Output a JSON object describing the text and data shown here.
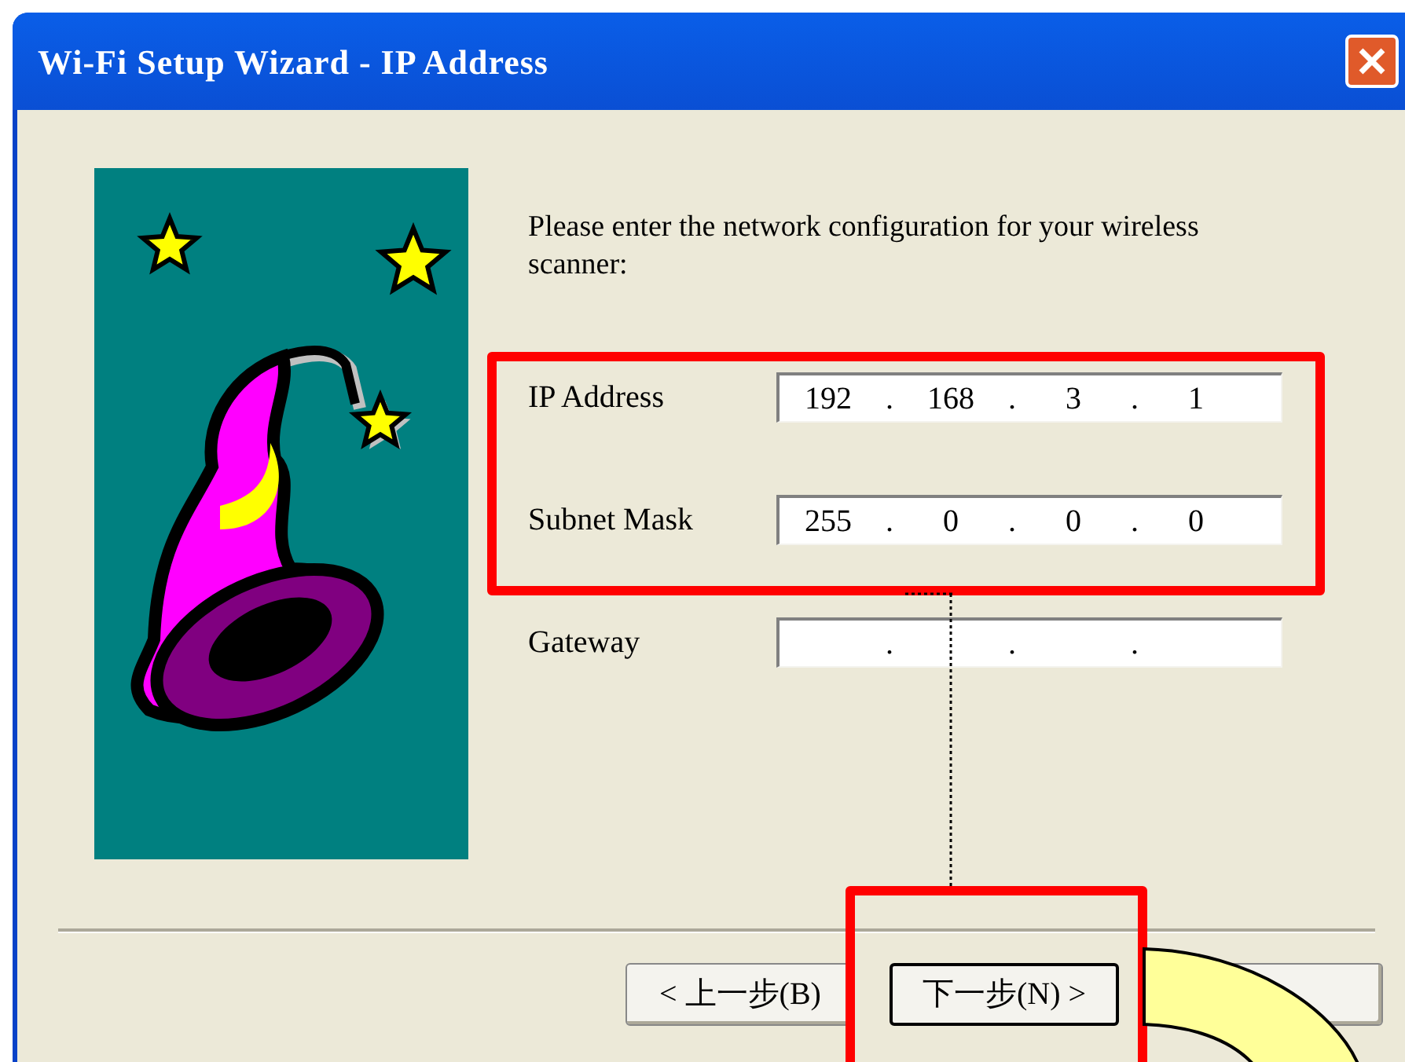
{
  "window": {
    "title": "Wi-Fi Setup Wizard - IP Address"
  },
  "instructions": "Please enter the network configuration for your wireless scanner:",
  "fields": [
    {
      "label": "IP Address",
      "separator": ".",
      "octets": [
        "192",
        "168",
        "3",
        "1"
      ]
    },
    {
      "label": "Subnet Mask",
      "separator": ".",
      "octets": [
        "255",
        "0",
        "0",
        "0"
      ]
    },
    {
      "label": "Gateway",
      "separator": "."
    }
  ],
  "buttons": [
    {
      "label": "< 上一步(B)",
      "default": false
    },
    {
      "label": "下一步(N) >",
      "default": true
    },
    {
      "default": false
    }
  ]
}
